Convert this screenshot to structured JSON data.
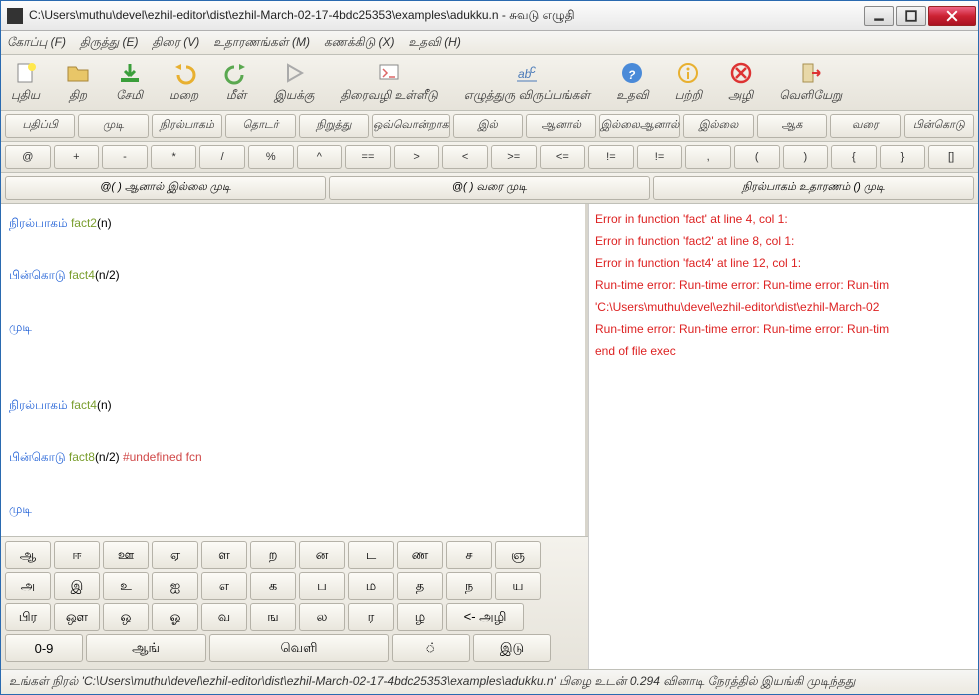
{
  "title": "C:\\Users\\muthu\\devel\\ezhil-editor\\dist\\ezhil-March-02-17-4bdc25353\\examples\\adukku.n - சுவடு எழுதி",
  "menu": [
    "கோப்பு (F)",
    "திருத்து (E)",
    "திரை (V)",
    "உதாரணங்கள் (M)",
    "கணக்கிடு (X)",
    "உதவி (H)"
  ],
  "toolbar": [
    {
      "name": "new",
      "label": "புதிய",
      "icon": "new"
    },
    {
      "name": "open",
      "label": "திற",
      "icon": "open"
    },
    {
      "name": "save",
      "label": "சேமி",
      "icon": "save"
    },
    {
      "name": "undo",
      "label": "மறை",
      "icon": "undo"
    },
    {
      "name": "redo",
      "label": "மீள்",
      "icon": "redo"
    },
    {
      "name": "run",
      "label": "இயக்கு",
      "icon": "run"
    },
    {
      "name": "screen",
      "label": "திரைவழி உள்ளீடு",
      "icon": "screen"
    },
    {
      "name": "font",
      "label": "எழுத்துரு விருப்பங்கள்",
      "icon": "font"
    },
    {
      "name": "help",
      "label": "உதவி",
      "icon": "help"
    },
    {
      "name": "about",
      "label": "பற்றி",
      "icon": "about"
    },
    {
      "name": "clear",
      "label": "அழி",
      "icon": "clear"
    },
    {
      "name": "exit",
      "label": "வெளியேறு",
      "icon": "exit"
    }
  ],
  "row1": [
    "பதிப்பி",
    "முடி",
    "நிரல்பாகம்",
    "தொடர்",
    "நிறுத்து",
    "ஒவ்வொன்றாக",
    "இல்",
    "ஆனால்",
    "இல்லைஆனால்",
    "இல்லை",
    "ஆக",
    "வரை",
    "பின்கொடு"
  ],
  "row2": [
    "@",
    "+",
    "-",
    "*",
    "/",
    "%",
    "^",
    "==",
    ">",
    "<",
    ">=",
    "<=",
    "!=",
    "!=",
    ",",
    "(",
    ")",
    "{",
    "}",
    "[]"
  ],
  "row3": [
    "@( ) ஆனால் இல்லை முடி",
    "@( ) வரை முடி",
    "நிரல்பாகம் உதாரணம் () முடி"
  ],
  "code": [
    {
      "t": "kw",
      "s": "நிரல்பாகம் "
    },
    {
      "t": "fn",
      "s": "fact2"
    },
    {
      "t": "prm",
      "s": "(n)"
    },
    {
      "t": "br"
    },
    {
      "t": "br"
    },
    {
      "t": "kw",
      "s": "பின்கொடு "
    },
    {
      "t": "fn",
      "s": "fact4"
    },
    {
      "t": "prm",
      "s": "(n/2)"
    },
    {
      "t": "br"
    },
    {
      "t": "br"
    },
    {
      "t": "kw",
      "s": "முடி"
    },
    {
      "t": "br"
    },
    {
      "t": "br"
    },
    {
      "t": "br"
    },
    {
      "t": "kw",
      "s": "நிரல்பாகம் "
    },
    {
      "t": "fn",
      "s": "fact4"
    },
    {
      "t": "prm",
      "s": "(n)"
    },
    {
      "t": "br"
    },
    {
      "t": "br"
    },
    {
      "t": "kw",
      "s": "பின்கொடு "
    },
    {
      "t": "fn",
      "s": "fact8"
    },
    {
      "t": "prm",
      "s": "(n/2) "
    },
    {
      "t": "cmt",
      "s": "#undefined fcn"
    },
    {
      "t": "br"
    },
    {
      "t": "br"
    },
    {
      "t": "kw",
      "s": "முடி"
    },
    {
      "t": "br"
    }
  ],
  "errors": [
    "Error in function 'fact' at  line 4, col 1:",
    " Error in function 'fact2' at  line 8, col 1:",
    "  Error in function 'fact4' at  line 12, col 1:",
    "Run-time error: Run-time error: Run-time error: Run-tim",
    " 'C:\\Users\\muthu\\devel\\ezhil-editor\\dist\\ezhil-March-02",
    "Run-time error: Run-time error: Run-time error: Run-tim",
    "end of file exec"
  ],
  "kb": {
    "r1": [
      "ஆ",
      "ஈ",
      "ஊ",
      "ஏ",
      "ள",
      "ற",
      "ன",
      "ட",
      "ண",
      "ச",
      "ஞ"
    ],
    "r2": [
      "அ",
      "இ",
      "உ",
      "ஐ",
      "எ",
      "க",
      "ப",
      "ம",
      "த",
      "ந",
      "ய"
    ],
    "r3": [
      "பிர",
      "ஔ",
      "ஒ",
      "ஓ",
      "வ",
      "ங",
      "ல",
      "ர",
      "ழ",
      "<- அழி"
    ],
    "r4": [
      "0-9",
      "ஆங்",
      "வெளி",
      "்",
      "இடு"
    ]
  },
  "status": "உங்கள் நிரல் 'C:\\Users\\muthu\\devel\\ezhil-editor\\dist\\ezhil-March-02-17-4bdc25353\\examples\\adukku.n' பிழை உடன் 0.294 வினாடி நேரத்தில் இயங்கி முடிந்தது"
}
